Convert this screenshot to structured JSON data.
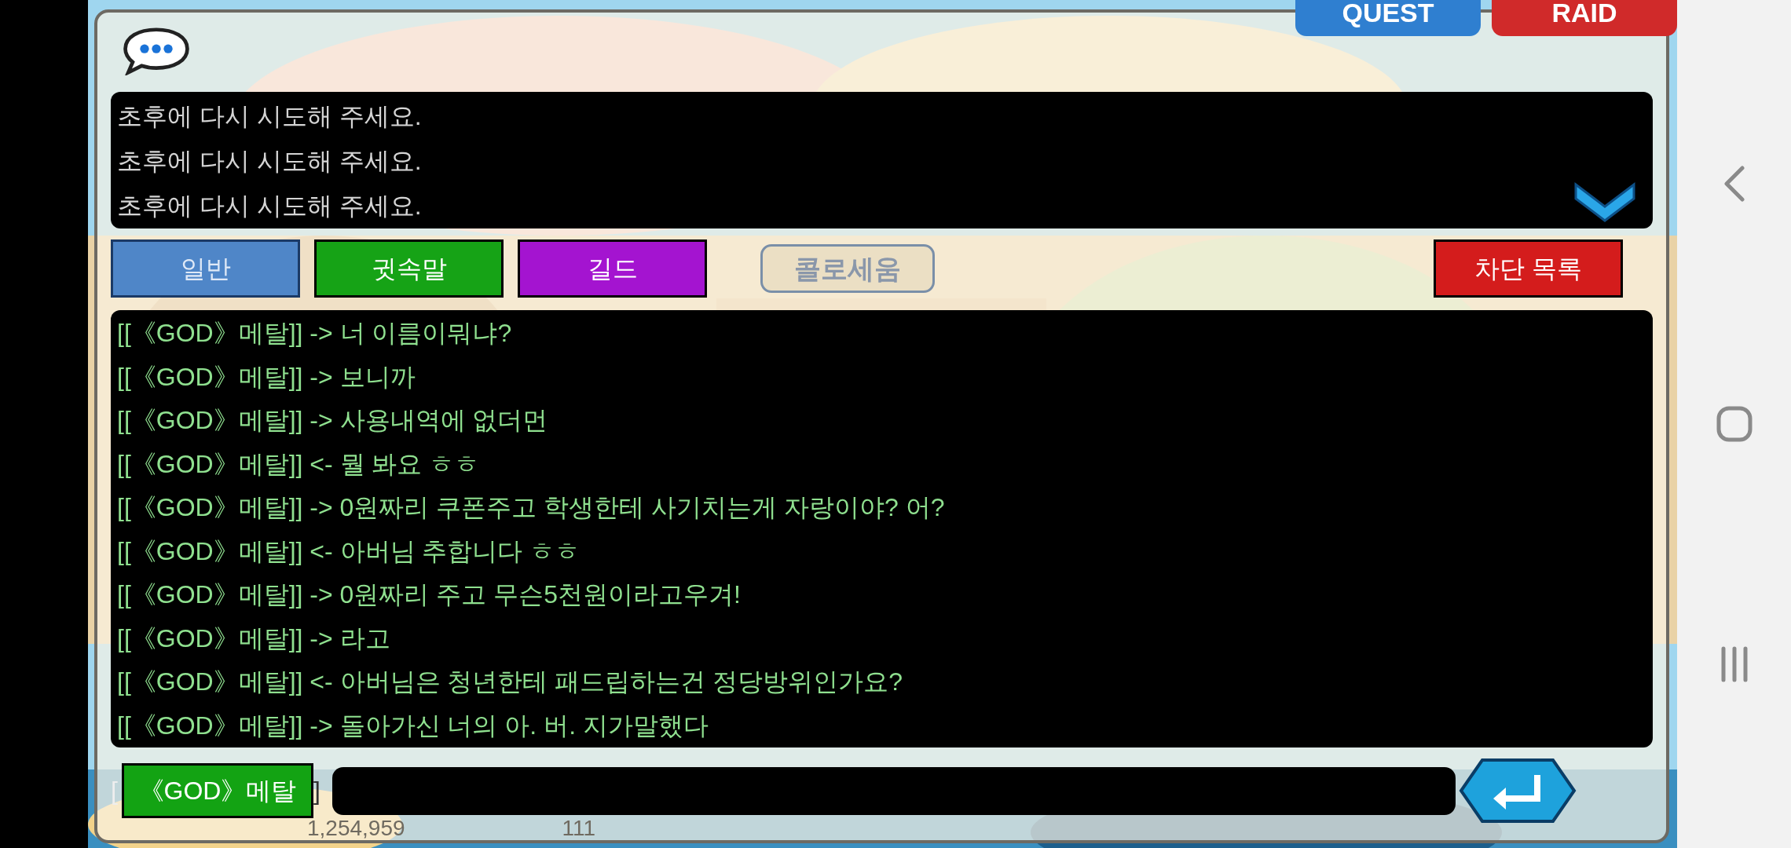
{
  "game_background": {
    "kind": "picture",
    "labels": [
      {
        "text": "QUEST",
        "color": "#2f7fd0"
      },
      {
        "text": "RAID",
        "color": "#d02a2a"
      }
    ],
    "center_label": "콜로세움",
    "currency": [
      "1,254,959",
      "111"
    ]
  },
  "system_messages": [
    "초후에 다시 시도해 주세요.",
    "초후에 다시 시도해 주세요.",
    "초후에 다시 시도해 주세요."
  ],
  "tabs": [
    {
      "label": "일반",
      "color": "#4f86c8",
      "selected": true
    },
    {
      "label": "귓속말",
      "color": "#16a316",
      "selected": false
    },
    {
      "label": "길드",
      "color": "#a414d0",
      "selected": false
    }
  ],
  "block_list_button": "차단 목록",
  "messages": [
    {
      "sender": "[[《GOD》메탈]]",
      "arrow": "->",
      "text": "너 이름이뭐냐?"
    },
    {
      "sender": "[[《GOD》메탈]]",
      "arrow": "->",
      "text": "보니까"
    },
    {
      "sender": "[[《GOD》메탈]]",
      "arrow": "->",
      "text": "사용내역에 없더먼"
    },
    {
      "sender": "[[《GOD》메탈]]",
      "arrow": "<-",
      "text": "뭘 봐요 ㅎㅎ"
    },
    {
      "sender": "[[《GOD》메탈]]",
      "arrow": "->",
      "text": "0원짜리 쿠폰주고 학생한테 사기치는게 자랑이야? 어?"
    },
    {
      "sender": "[[《GOD》메탈]]",
      "arrow": "<-",
      "text": "아버님 추합니다 ㅎㅎ"
    },
    {
      "sender": "[[《GOD》메탈]]",
      "arrow": "->",
      "text": "0원짜리 주고 무슨5천원이라고우겨!"
    },
    {
      "sender": "[[《GOD》메탈]]",
      "arrow": "->",
      "text": "라고"
    },
    {
      "sender": "[[《GOD》메탈]]",
      "arrow": "<-",
      "text": "아버님은 청년한테 패드립하는건 정당방위인가요?"
    },
    {
      "sender": "[[《GOD》메탈]]",
      "arrow": "->",
      "text": "돌아가신 너의 아. 버. 지가말했다"
    }
  ],
  "recipient": {
    "open": "[",
    "name": "《GOD》메탈",
    "close": "]"
  }
}
